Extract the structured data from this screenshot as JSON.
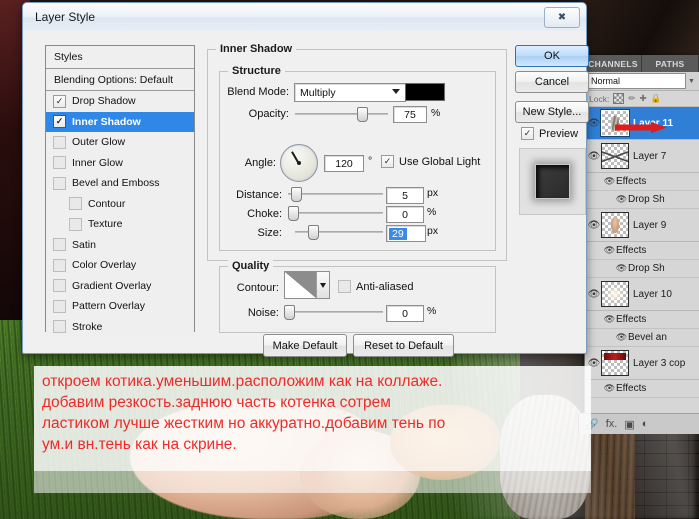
{
  "dialog": {
    "title": "Layer Style",
    "close_icon": "close-icon",
    "styles_panel": {
      "header": "Styles",
      "blending_options": "Blending Options: Default",
      "items": [
        {
          "label": "Drop Shadow",
          "checked": true,
          "selected": false,
          "indent": false
        },
        {
          "label": "Inner Shadow",
          "checked": true,
          "selected": true,
          "indent": false
        },
        {
          "label": "Outer Glow",
          "checked": false,
          "selected": false,
          "indent": false
        },
        {
          "label": "Inner Glow",
          "checked": false,
          "selected": false,
          "indent": false
        },
        {
          "label": "Bevel and Emboss",
          "checked": false,
          "selected": false,
          "indent": false
        },
        {
          "label": "Contour",
          "checked": false,
          "selected": false,
          "indent": true
        },
        {
          "label": "Texture",
          "checked": false,
          "selected": false,
          "indent": true
        },
        {
          "label": "Satin",
          "checked": false,
          "selected": false,
          "indent": false
        },
        {
          "label": "Color Overlay",
          "checked": false,
          "selected": false,
          "indent": false
        },
        {
          "label": "Gradient Overlay",
          "checked": false,
          "selected": false,
          "indent": false
        },
        {
          "label": "Pattern Overlay",
          "checked": false,
          "selected": false,
          "indent": false
        },
        {
          "label": "Stroke",
          "checked": false,
          "selected": false,
          "indent": false
        }
      ]
    },
    "inner_shadow": {
      "group_label": "Inner Shadow",
      "structure_label": "Structure",
      "blend_mode_label": "Blend Mode:",
      "blend_mode_value": "Multiply",
      "shadow_color": "#000000",
      "opacity_label": "Opacity:",
      "opacity_value": "75",
      "opacity_unit": "%",
      "angle_label": "Angle:",
      "angle_value": "120",
      "angle_unit": "°",
      "use_global_light": "Use Global Light",
      "use_global_light_checked": true,
      "distance_label": "Distance:",
      "distance_value": "5",
      "distance_unit": "px",
      "choke_label": "Choke:",
      "choke_value": "0",
      "choke_unit": "%",
      "size_label": "Size:",
      "size_value": "29",
      "size_unit": "px",
      "size_selected": true
    },
    "quality": {
      "group_label": "Quality",
      "contour_label": "Contour:",
      "anti_aliased_label": "Anti-aliased",
      "anti_aliased_checked": false,
      "noise_label": "Noise:",
      "noise_value": "0",
      "noise_unit": "%"
    },
    "buttons": {
      "make_default": "Make Default",
      "reset_to_default": "Reset to Default",
      "ok": "OK",
      "cancel": "Cancel",
      "new_style": "New Style...",
      "preview": "Preview",
      "preview_checked": true
    }
  },
  "layers_panel": {
    "tabs": [
      {
        "label": "CHANNELS",
        "active": false
      },
      {
        "label": "PATHS",
        "active": false
      }
    ],
    "blend_mode": "Normal",
    "lock_label": "Lock:",
    "lock_icons": [
      "transparency-lock-icon",
      "brush-lock-icon",
      "move-lock-icon",
      "lock-all-icon"
    ],
    "rows": [
      {
        "type": "layer",
        "name": "Layer 11",
        "selected": true,
        "visible": true,
        "thumb": "cat"
      },
      {
        "type": "layer",
        "name": "Layer 7",
        "selected": false,
        "visible": true,
        "thumb": "curve"
      },
      {
        "type": "effects",
        "name": "Effects",
        "visible": true
      },
      {
        "type": "effect",
        "name": "Drop Sh",
        "visible": true
      },
      {
        "type": "layer",
        "name": "Layer 9",
        "selected": false,
        "visible": true,
        "thumb": "figure"
      },
      {
        "type": "effects",
        "name": "Effects",
        "visible": true
      },
      {
        "type": "effect",
        "name": "Drop Sh",
        "visible": true
      },
      {
        "type": "layer",
        "name": "Layer 10",
        "selected": false,
        "visible": true,
        "thumb": "light"
      },
      {
        "type": "effects",
        "name": "Effects",
        "visible": true
      },
      {
        "type": "effect",
        "name": "Bevel an",
        "visible": true
      },
      {
        "type": "layer",
        "name": "Layer 3 cop",
        "selected": false,
        "visible": true,
        "thumb": "red"
      },
      {
        "type": "effects",
        "name": "Effects",
        "visible": true
      }
    ],
    "toolbar_icons": [
      "link-icon",
      "fx-icon",
      "mask-icon",
      "adjustment-icon"
    ],
    "toolbar_fx_label": "fx."
  },
  "annotation": {
    "color": "#ef2a2a",
    "lines": [
      "откроем котика.уменьшим.расположим как на коллаже.",
      "добавим резкость.заднюю часть котенка сотрем",
      "ластиком лучше жестким но аккуратно.добавим тень по",
      "ум.и вн.тень как на скрине."
    ]
  }
}
